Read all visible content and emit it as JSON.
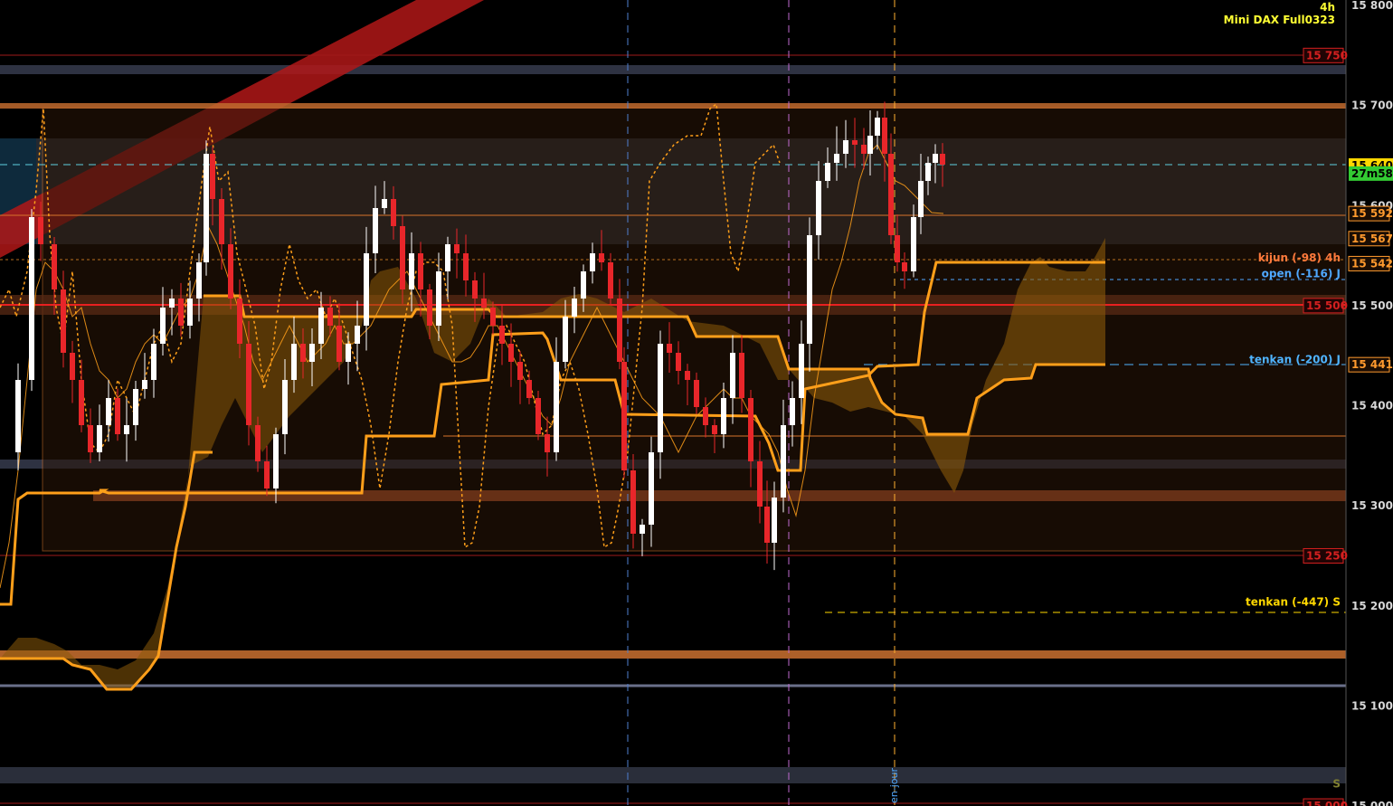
{
  "header": {
    "timeframe": "4h",
    "instrument": "Mini DAX Full0323"
  },
  "price_axis": {
    "labels": [
      "15 800",
      "15 700",
      "15 600",
      "15 500",
      "15 400",
      "15 300",
      "15 200",
      "15 100",
      "15 000"
    ],
    "values": [
      15800,
      15700,
      15600,
      15500,
      15400,
      15300,
      15200,
      15100,
      15000
    ],
    "right_tags": [
      {
        "text": "15 750",
        "value": 15750,
        "color": "#d42020",
        "style": "boxed-dark"
      },
      {
        "text": "15 640",
        "value": 15640,
        "color": "#ffd800",
        "style": "filled"
      },
      {
        "text": "27m58s",
        "value": 15632,
        "color": "#33cc33",
        "style": "filled"
      },
      {
        "text": "15 592",
        "value": 15592,
        "color": "#ff9a2e",
        "style": "boxed"
      },
      {
        "text": "15 567",
        "value": 15567,
        "color": "#ff9a2e",
        "style": "boxed"
      },
      {
        "text": "15 542",
        "value": 15542,
        "color": "#ff9a2e",
        "style": "boxed"
      },
      {
        "text": "15 500",
        "value": 15500,
        "color": "#d42020",
        "style": "boxed-dark"
      },
      {
        "text": "15 441",
        "value": 15441,
        "color": "#ff9a2e",
        "style": "boxed"
      },
      {
        "text": "15 250",
        "value": 15250,
        "color": "#d42020",
        "style": "boxed-dark"
      },
      {
        "text": "15 000",
        "value": 15000,
        "color": "#d42020",
        "style": "boxed-dark"
      }
    ]
  },
  "annotations": [
    {
      "text": "kijun (-98) 4h",
      "value": 15548,
      "color": "#ff7a3c"
    },
    {
      "text": "open (-116) J",
      "value": 15532,
      "color": "#4fa8ff"
    },
    {
      "text": "tenkan (-200) J",
      "value": 15446,
      "color": "#4fb4ff"
    },
    {
      "text": "tenkan (-447) S",
      "value": 15204,
      "color": "#ffd800"
    },
    {
      "text": "S",
      "value": 15022,
      "color": "#808030"
    }
  ],
  "vertical_label": "en-jour",
  "colors": {
    "background": "#000000",
    "bull": "#ffffff",
    "bear": "#e8262a",
    "ichimoku": "#ff9f1a",
    "cloud": "#8a5a0a",
    "box": "#ff7a3c"
  }
}
